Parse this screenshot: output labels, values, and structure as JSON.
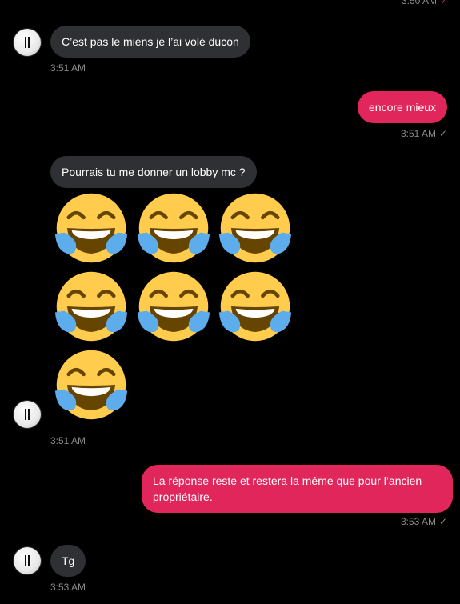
{
  "messages": {
    "top_time": "3:50 AM",
    "m1": {
      "text": "C’est pas le miens je l’ai volé ducon",
      "time": "3:51 AM"
    },
    "m2": {
      "text": "encore mieux",
      "time": "3:51 AM"
    },
    "m3": {
      "text": "Pourrais tu me donner un lobby mc ?",
      "time": "3:51 AM",
      "emoji_name": "face-with-tears-of-joy-icon",
      "emoji_count": 7
    },
    "m4": {
      "text": "La réponse reste et restera la même que pour l’ancien propriétaire.",
      "time": "3:53 AM"
    },
    "m5": {
      "text": "Tg",
      "time": "3:53 AM"
    }
  },
  "icons": {
    "avatar": "avatar-icon",
    "read_check": "check-icon",
    "emoji": "face-with-tears-of-joy-icon"
  },
  "colors": {
    "background": "#000000",
    "incoming_bubble": "#2f3033",
    "outgoing_bubble": "#e1265b",
    "timestamp": "#8b8b8b",
    "emoji_face": "#ffcc4d",
    "emoji_tear": "#5dadec"
  }
}
